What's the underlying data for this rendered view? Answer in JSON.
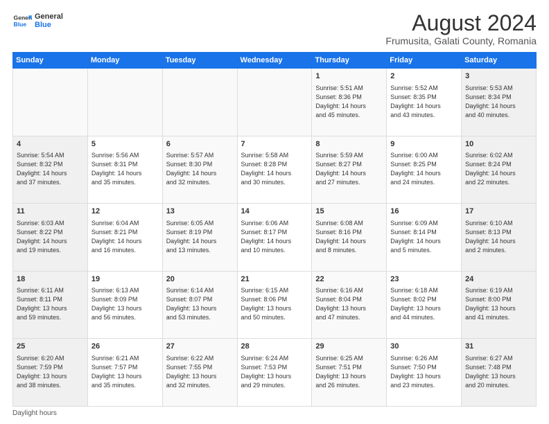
{
  "logo": {
    "line1": "General",
    "line2": "Blue"
  },
  "title": "August 2024",
  "subtitle": "Frumusita, Galati County, Romania",
  "days_header": [
    "Sunday",
    "Monday",
    "Tuesday",
    "Wednesday",
    "Thursday",
    "Friday",
    "Saturday"
  ],
  "weeks": [
    [
      {
        "day": "",
        "info": ""
      },
      {
        "day": "",
        "info": ""
      },
      {
        "day": "",
        "info": ""
      },
      {
        "day": "",
        "info": ""
      },
      {
        "day": "1",
        "info": "Sunrise: 5:51 AM\nSunset: 8:36 PM\nDaylight: 14 hours\nand 45 minutes."
      },
      {
        "day": "2",
        "info": "Sunrise: 5:52 AM\nSunset: 8:35 PM\nDaylight: 14 hours\nand 43 minutes."
      },
      {
        "day": "3",
        "info": "Sunrise: 5:53 AM\nSunset: 8:34 PM\nDaylight: 14 hours\nand 40 minutes."
      }
    ],
    [
      {
        "day": "4",
        "info": "Sunrise: 5:54 AM\nSunset: 8:32 PM\nDaylight: 14 hours\nand 37 minutes."
      },
      {
        "day": "5",
        "info": "Sunrise: 5:56 AM\nSunset: 8:31 PM\nDaylight: 14 hours\nand 35 minutes."
      },
      {
        "day": "6",
        "info": "Sunrise: 5:57 AM\nSunset: 8:30 PM\nDaylight: 14 hours\nand 32 minutes."
      },
      {
        "day": "7",
        "info": "Sunrise: 5:58 AM\nSunset: 8:28 PM\nDaylight: 14 hours\nand 30 minutes."
      },
      {
        "day": "8",
        "info": "Sunrise: 5:59 AM\nSunset: 8:27 PM\nDaylight: 14 hours\nand 27 minutes."
      },
      {
        "day": "9",
        "info": "Sunrise: 6:00 AM\nSunset: 8:25 PM\nDaylight: 14 hours\nand 24 minutes."
      },
      {
        "day": "10",
        "info": "Sunrise: 6:02 AM\nSunset: 8:24 PM\nDaylight: 14 hours\nand 22 minutes."
      }
    ],
    [
      {
        "day": "11",
        "info": "Sunrise: 6:03 AM\nSunset: 8:22 PM\nDaylight: 14 hours\nand 19 minutes."
      },
      {
        "day": "12",
        "info": "Sunrise: 6:04 AM\nSunset: 8:21 PM\nDaylight: 14 hours\nand 16 minutes."
      },
      {
        "day": "13",
        "info": "Sunrise: 6:05 AM\nSunset: 8:19 PM\nDaylight: 14 hours\nand 13 minutes."
      },
      {
        "day": "14",
        "info": "Sunrise: 6:06 AM\nSunset: 8:17 PM\nDaylight: 14 hours\nand 10 minutes."
      },
      {
        "day": "15",
        "info": "Sunrise: 6:08 AM\nSunset: 8:16 PM\nDaylight: 14 hours\nand 8 minutes."
      },
      {
        "day": "16",
        "info": "Sunrise: 6:09 AM\nSunset: 8:14 PM\nDaylight: 14 hours\nand 5 minutes."
      },
      {
        "day": "17",
        "info": "Sunrise: 6:10 AM\nSunset: 8:13 PM\nDaylight: 14 hours\nand 2 minutes."
      }
    ],
    [
      {
        "day": "18",
        "info": "Sunrise: 6:11 AM\nSunset: 8:11 PM\nDaylight: 13 hours\nand 59 minutes."
      },
      {
        "day": "19",
        "info": "Sunrise: 6:13 AM\nSunset: 8:09 PM\nDaylight: 13 hours\nand 56 minutes."
      },
      {
        "day": "20",
        "info": "Sunrise: 6:14 AM\nSunset: 8:07 PM\nDaylight: 13 hours\nand 53 minutes."
      },
      {
        "day": "21",
        "info": "Sunrise: 6:15 AM\nSunset: 8:06 PM\nDaylight: 13 hours\nand 50 minutes."
      },
      {
        "day": "22",
        "info": "Sunrise: 6:16 AM\nSunset: 8:04 PM\nDaylight: 13 hours\nand 47 minutes."
      },
      {
        "day": "23",
        "info": "Sunrise: 6:18 AM\nSunset: 8:02 PM\nDaylight: 13 hours\nand 44 minutes."
      },
      {
        "day": "24",
        "info": "Sunrise: 6:19 AM\nSunset: 8:00 PM\nDaylight: 13 hours\nand 41 minutes."
      }
    ],
    [
      {
        "day": "25",
        "info": "Sunrise: 6:20 AM\nSunset: 7:59 PM\nDaylight: 13 hours\nand 38 minutes."
      },
      {
        "day": "26",
        "info": "Sunrise: 6:21 AM\nSunset: 7:57 PM\nDaylight: 13 hours\nand 35 minutes."
      },
      {
        "day": "27",
        "info": "Sunrise: 6:22 AM\nSunset: 7:55 PM\nDaylight: 13 hours\nand 32 minutes."
      },
      {
        "day": "28",
        "info": "Sunrise: 6:24 AM\nSunset: 7:53 PM\nDaylight: 13 hours\nand 29 minutes."
      },
      {
        "day": "29",
        "info": "Sunrise: 6:25 AM\nSunset: 7:51 PM\nDaylight: 13 hours\nand 26 minutes."
      },
      {
        "day": "30",
        "info": "Sunrise: 6:26 AM\nSunset: 7:50 PM\nDaylight: 13 hours\nand 23 minutes."
      },
      {
        "day": "31",
        "info": "Sunrise: 6:27 AM\nSunset: 7:48 PM\nDaylight: 13 hours\nand 20 minutes."
      }
    ]
  ],
  "footer": "Daylight hours"
}
